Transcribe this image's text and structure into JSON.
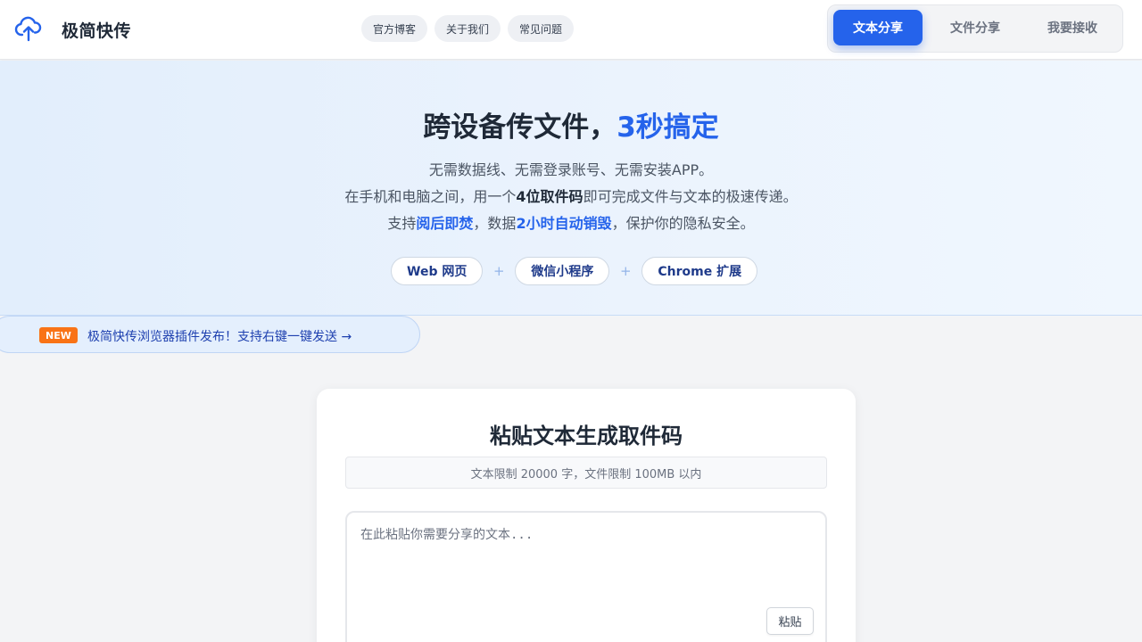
{
  "header": {
    "brand": "极简快传",
    "logo_icon": "cloud-upload-icon",
    "nav": [
      {
        "label": "官方博客"
      },
      {
        "label": "关于我们"
      },
      {
        "label": "常见问题"
      }
    ],
    "mode_tabs": [
      {
        "label": "文本分享",
        "active": true
      },
      {
        "label": "文件分享",
        "active": false
      },
      {
        "label": "我要接收",
        "active": false
      }
    ]
  },
  "hero": {
    "title_main": "跨设备传文件，",
    "title_accent": "3秒搞定",
    "line1": "无需数据线、无需登录账号、无需安装APP。",
    "line2_a": "在手机和电脑之间，用一个",
    "line2_b": "4位取件码",
    "line2_c": "即可完成文件与文本的极速传递。",
    "line3_a": "支持",
    "line3_b": "阅后即焚",
    "line3_c": "，数据",
    "line3_d": "2小时自动销毁",
    "line3_e": "，保护你的隐私安全。",
    "platforms": [
      "Web 网页",
      "微信小程序",
      "Chrome 扩展"
    ],
    "separator": "+"
  },
  "announcement": {
    "badge": "NEW",
    "text": "极简快传浏览器插件发布！支持右键一键发送 →"
  },
  "card": {
    "title": "粘贴文本生成取件码",
    "limits": "文本限制 20000 字，文件限制 100MB 以内",
    "textarea_placeholder": "在此粘贴你需要分享的文本...",
    "textarea_value": "",
    "paste_button": "粘贴"
  },
  "colors": {
    "accent": "#2563eb",
    "badge": "#f97316",
    "background": "#f3f4f6"
  }
}
